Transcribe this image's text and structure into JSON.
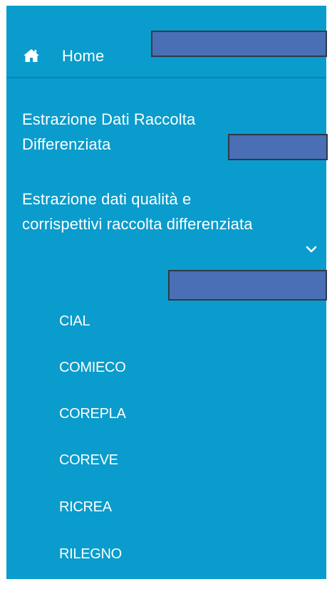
{
  "nav": {
    "home": {
      "icon": "home-icon",
      "label": "Home"
    },
    "items": [
      {
        "label": "Estrazione Dati Raccolta Differenziata"
      },
      {
        "label": "Estrazione dati qualità e corrispettivi raccolta differenziata",
        "icon": "chevron-down-icon",
        "expanded": true
      }
    ],
    "sub_items": [
      "CIAL",
      "COMIECO",
      "COREPLA",
      "COREVE",
      "RICREA",
      "RILEGNO"
    ]
  },
  "colors": {
    "sidebar_bg": "#0a9ccc",
    "text": "#ffffff",
    "redaction_fill": "#4a6fb4"
  }
}
